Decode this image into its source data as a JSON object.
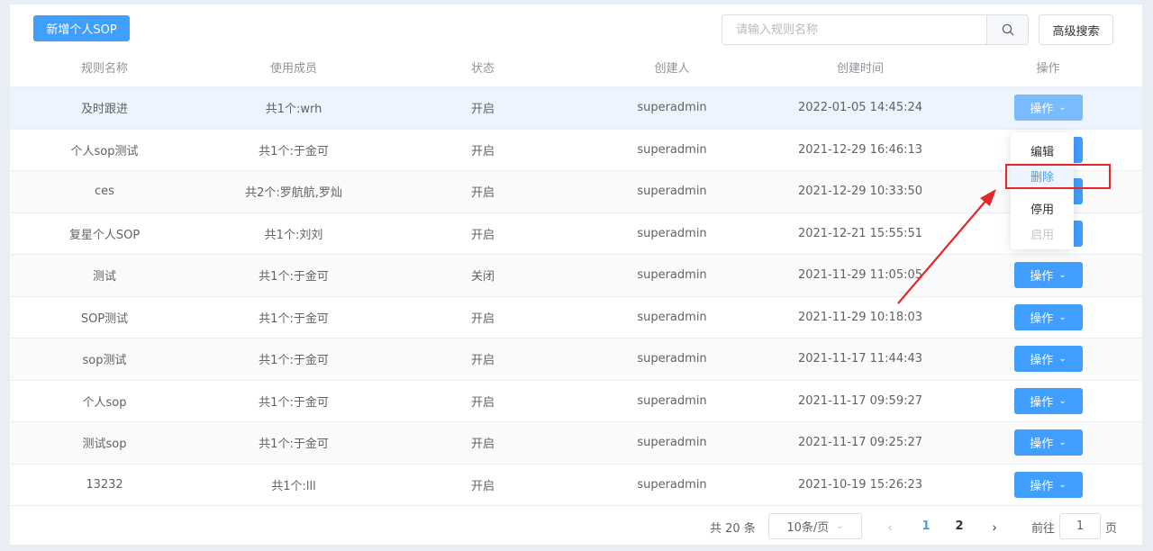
{
  "toolbar": {
    "add_label": "新增个人SOP",
    "search_placeholder": "请输入规则名称",
    "advanced_label": "高级搜索"
  },
  "columns": [
    "规则名称",
    "使用成员",
    "状态",
    "创建人",
    "创建时间",
    "操作"
  ],
  "rows": [
    {
      "name": "及时跟进",
      "members": "共1个:wrh",
      "status": "开启",
      "creator": "superadmin",
      "created": "2022-01-05 14:45:24"
    },
    {
      "name": "个人sop测试",
      "members": "共1个:于金可",
      "status": "开启",
      "creator": "superadmin",
      "created": "2021-12-29 16:46:13"
    },
    {
      "name": "ces",
      "members": "共2个:罗航航,罗灿",
      "status": "开启",
      "creator": "superadmin",
      "created": "2021-12-29 10:33:50"
    },
    {
      "name": "复星个人SOP",
      "members": "共1个:刘刘",
      "status": "开启",
      "creator": "superadmin",
      "created": "2021-12-21 15:55:51"
    },
    {
      "name": "测试",
      "members": "共1个:于金可",
      "status": "关闭",
      "creator": "superadmin",
      "created": "2021-11-29 11:05:05"
    },
    {
      "name": "SOP测试",
      "members": "共1个:于金可",
      "status": "开启",
      "creator": "superadmin",
      "created": "2021-11-29 10:18:03"
    },
    {
      "name": "sop测试",
      "members": "共1个:于金可",
      "status": "开启",
      "creator": "superadmin",
      "created": "2021-11-17 11:44:43"
    },
    {
      "name": "个人sop",
      "members": "共1个:于金可",
      "status": "开启",
      "creator": "superadmin",
      "created": "2021-11-17 09:59:27"
    },
    {
      "name": "测试sop",
      "members": "共1个:于金可",
      "status": "开启",
      "creator": "superadmin",
      "created": "2021-11-17 09:25:27"
    },
    {
      "name": "13232",
      "members": "共1个:lll",
      "status": "开启",
      "creator": "superadmin",
      "created": "2021-10-19 15:26:23"
    }
  ],
  "action_label": "操作",
  "dropdown": {
    "items": [
      "编辑",
      "删除",
      "停用",
      "启用"
    ],
    "hovered": "删除",
    "disabled": [
      "启用"
    ]
  },
  "pagination": {
    "total_label": "共 20 条",
    "page_size": "10条/页",
    "pages": [
      "1",
      "2"
    ],
    "current_page": "1",
    "goto_label": "前往",
    "goto_value": "1",
    "page_suffix": "页"
  },
  "colors": {
    "primary": "#409eff",
    "annotation_red": "#e5262a"
  }
}
